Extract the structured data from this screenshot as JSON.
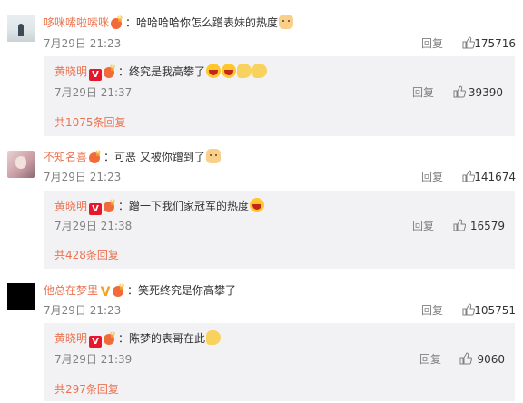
{
  "threads": [
    {
      "user": "哆咪嗦啦嗦咪",
      "text": "：哈哈哈哈你怎么蹭表妹的热度",
      "time": "7月29日 21:23",
      "reply_label": "回复",
      "likes": "175716",
      "sub": {
        "user": "黄晓明",
        "text": "：终究是我高攀了",
        "time": "7月29日 21:37",
        "reply_label": "回复",
        "likes": "39390",
        "more": "共1075条回复"
      }
    },
    {
      "user": "不知名喜",
      "text": "：可恶 又被你蹭到了",
      "time": "7月29日 21:23",
      "reply_label": "回复",
      "likes": "141674",
      "sub": {
        "user": "黄晓明",
        "text": "：蹭一下我们家冠军的热度",
        "time": "7月29日 21:38",
        "reply_label": "回复",
        "likes": "16579",
        "more": "共428条回复"
      }
    },
    {
      "user": "他总在梦里",
      "text": "：笑死终究是你高攀了",
      "time": "7月29日 21:23",
      "reply_label": "回复",
      "likes": "105751",
      "sub": {
        "user": "黄晓明",
        "text": "：陈梦的表哥在此",
        "time": "7月29日 21:39",
        "reply_label": "回复",
        "likes": "9060",
        "more": "共297条回复"
      }
    }
  ],
  "icons": {
    "verified_badge": "verified-v-badge-icon",
    "vip": "vip-crown-icon",
    "like": "thumbs-up-icon"
  },
  "colors": {
    "username": "#eb7350",
    "meta": "#808080",
    "reply_bg": "#f2f2f5",
    "verified": "#e6162d"
  }
}
